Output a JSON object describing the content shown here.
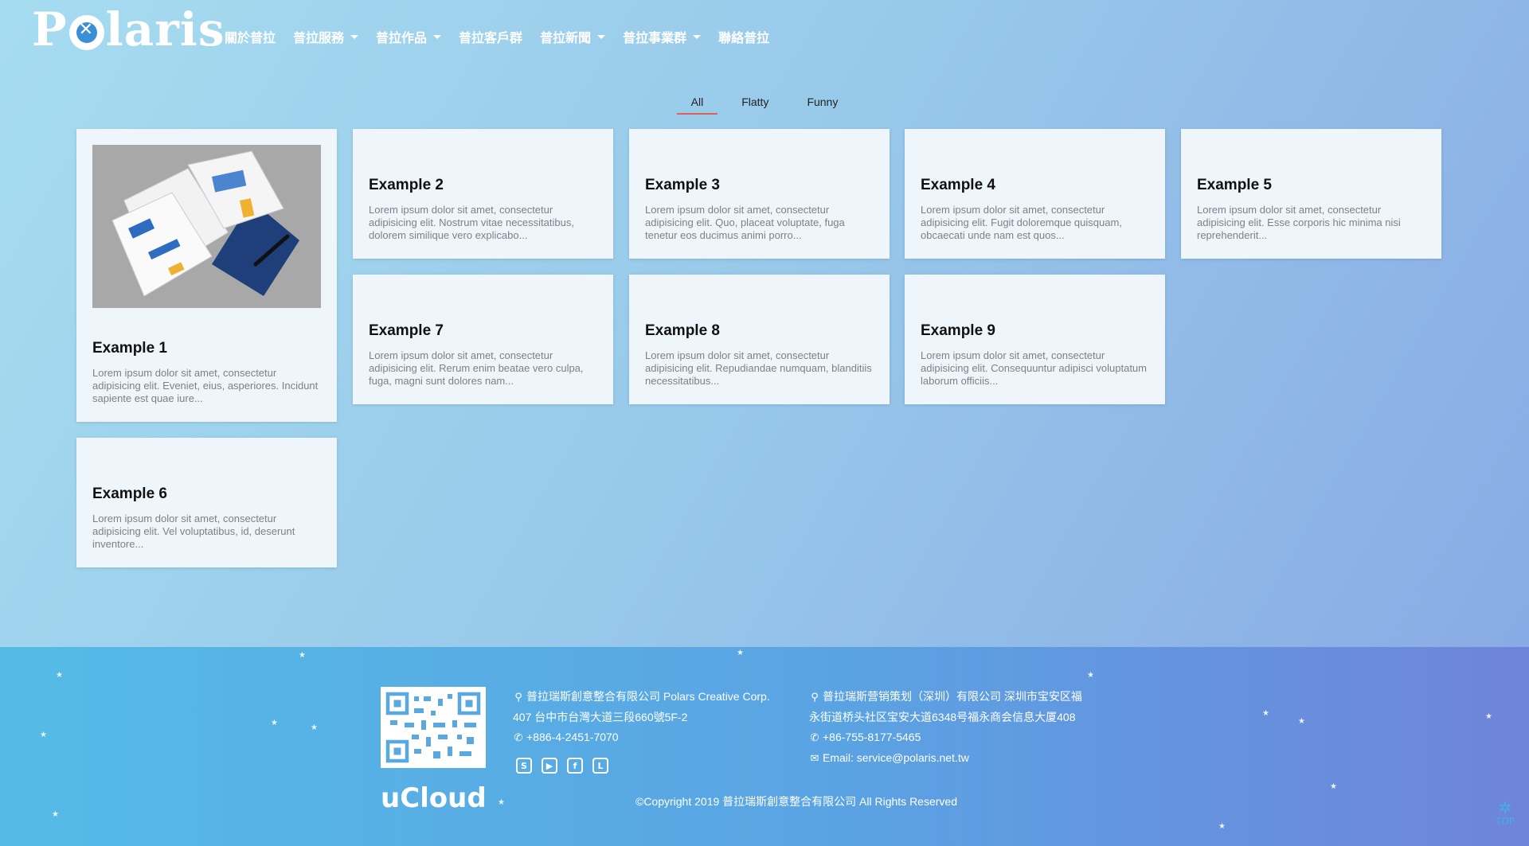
{
  "header": {
    "logo_text": "Polaris",
    "nav": [
      {
        "label": "關於普拉",
        "dropdown": false
      },
      {
        "label": "普拉服務",
        "dropdown": true
      },
      {
        "label": "普拉作品",
        "dropdown": true
      },
      {
        "label": "普拉客戶群",
        "dropdown": false
      },
      {
        "label": "普拉新聞",
        "dropdown": true
      },
      {
        "label": "普拉事業群",
        "dropdown": true
      },
      {
        "label": "聯絡普拉",
        "dropdown": false
      }
    ]
  },
  "filters": [
    {
      "label": "All",
      "active": true
    },
    {
      "label": "Flatty",
      "active": false
    },
    {
      "label": "Funny",
      "active": false
    }
  ],
  "cards": [
    {
      "title": "Example 1",
      "text": "Lorem ipsum dolor sit amet, consectetur adipisicing elit. Eveniet, eius, asperiores. Incidunt sapiente est quae iure...",
      "has_image": true
    },
    {
      "title": "Example 2",
      "text": "Lorem ipsum dolor sit amet, consectetur adipisicing elit. Nostrum vitae necessitatibus, dolorem similique vero explicabo..."
    },
    {
      "title": "Example 3",
      "text": "Lorem ipsum dolor sit amet, consectetur adipisicing elit. Quo, placeat voluptate, fuga tenetur eos ducimus animi porro..."
    },
    {
      "title": "Example 4",
      "text": "Lorem ipsum dolor sit amet, consectetur adipisicing elit. Fugit doloremque quisquam, obcaecati unde nam est quos..."
    },
    {
      "title": "Example 5",
      "text": "Lorem ipsum dolor sit amet, consectetur adipisicing elit. Esse corporis hic minima nisi reprehenderit..."
    },
    {
      "title": "Example 7",
      "text": "Lorem ipsum dolor sit amet, consectetur adipisicing elit. Rerum enim beatae vero culpa, fuga, magni sunt dolores nam..."
    },
    {
      "title": "Example 8",
      "text": "Lorem ipsum dolor sit amet, consectetur adipisicing elit. Repudiandae numquam, blanditiis necessitatibus..."
    },
    {
      "title": "Example 9",
      "text": "Lorem ipsum dolor sit amet, consectetur adipisicing elit. Consequuntur adipisci voluptatum laborum officiis..."
    },
    {
      "title": "Example 6",
      "text": "Lorem ipsum dolor sit amet, consectetur adipisicing elit. Vel voluptatibus, id, deserunt inventore..."
    }
  ],
  "footer": {
    "qr_caption": "uCloud",
    "taiwan": {
      "line1": "普拉瑞斯創意整合有限公司 Polars Creative Corp.",
      "line2": "407 台中市台灣大道三段660號5F-2",
      "phone": "+886-4-2451-7070"
    },
    "shenzhen": {
      "line1": "普拉瑞斯营销策划（深圳）有限公司 深圳市宝安区福",
      "line2": "永街道桥头社区宝安大道6348号福永商会信息大厦408",
      "phone": "+86-755-8177-5465",
      "email": "Email: service@polaris.net.tw"
    },
    "social_icons": [
      "skype-icon",
      "youtube-icon",
      "facebook-icon",
      "line-icon"
    ],
    "copyright": "©Copyright 2019 普拉瑞斯創意整合有限公司 All Rights Reserved",
    "top_label": "TOP"
  },
  "colors": {
    "filter_underline": "#e0605a",
    "footer_accent": "#3fb1e8"
  }
}
